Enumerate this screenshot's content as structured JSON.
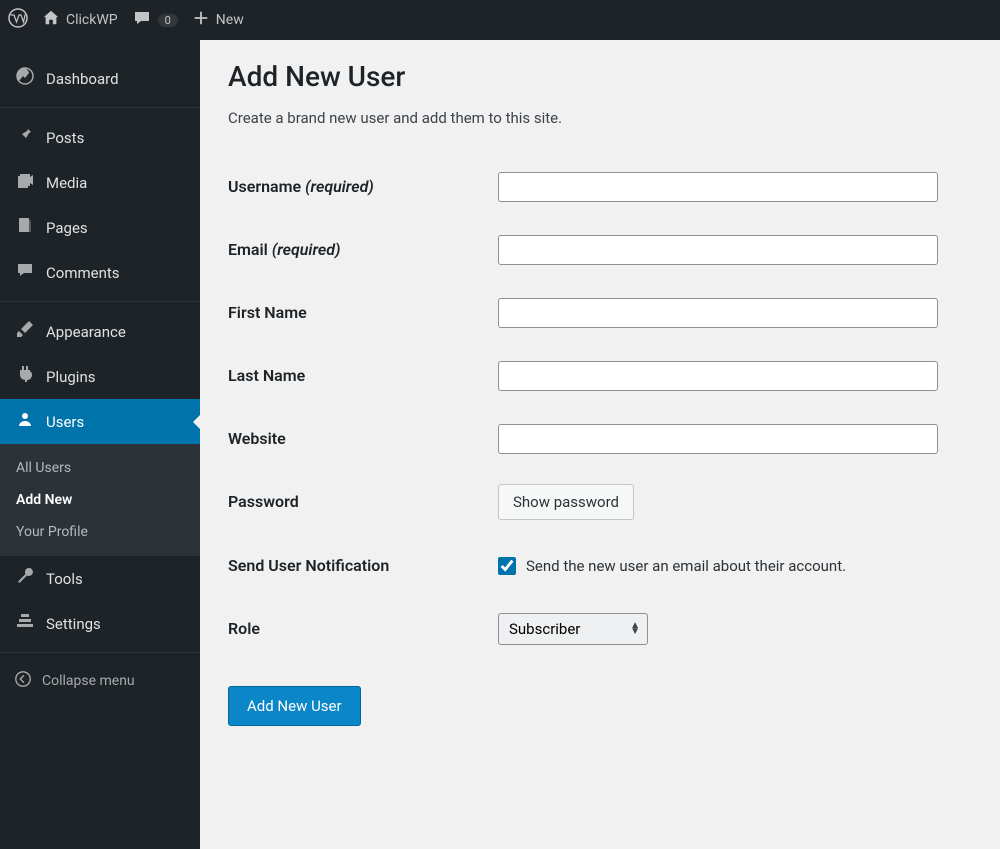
{
  "toolbar": {
    "site_name": "ClickWP",
    "comments_count": "0",
    "new_label": "New"
  },
  "sidebar": {
    "items": [
      {
        "label": "Dashboard"
      },
      {
        "label": "Posts"
      },
      {
        "label": "Media"
      },
      {
        "label": "Pages"
      },
      {
        "label": "Comments"
      },
      {
        "label": "Appearance"
      },
      {
        "label": "Plugins"
      },
      {
        "label": "Users"
      },
      {
        "label": "Tools"
      },
      {
        "label": "Settings"
      }
    ],
    "submenu": {
      "all_users": "All Users",
      "add_new": "Add New",
      "your_profile": "Your Profile"
    },
    "collapse_label": "Collapse menu"
  },
  "page": {
    "title": "Add New User",
    "description": "Create a brand new user and add them to this site.",
    "submit_label": "Add New User"
  },
  "form": {
    "username": {
      "label": "Username ",
      "required": "(required)",
      "value": ""
    },
    "email": {
      "label": "Email ",
      "required": "(required)",
      "value": ""
    },
    "first_name": {
      "label": "First Name",
      "value": ""
    },
    "last_name": {
      "label": "Last Name",
      "value": ""
    },
    "website": {
      "label": "Website",
      "value": ""
    },
    "password": {
      "label": "Password",
      "button": "Show password"
    },
    "notification": {
      "label": "Send User Notification",
      "checkbox_label": "Send the new user an email about their account."
    },
    "role": {
      "label": "Role",
      "selected": "Subscriber"
    }
  }
}
